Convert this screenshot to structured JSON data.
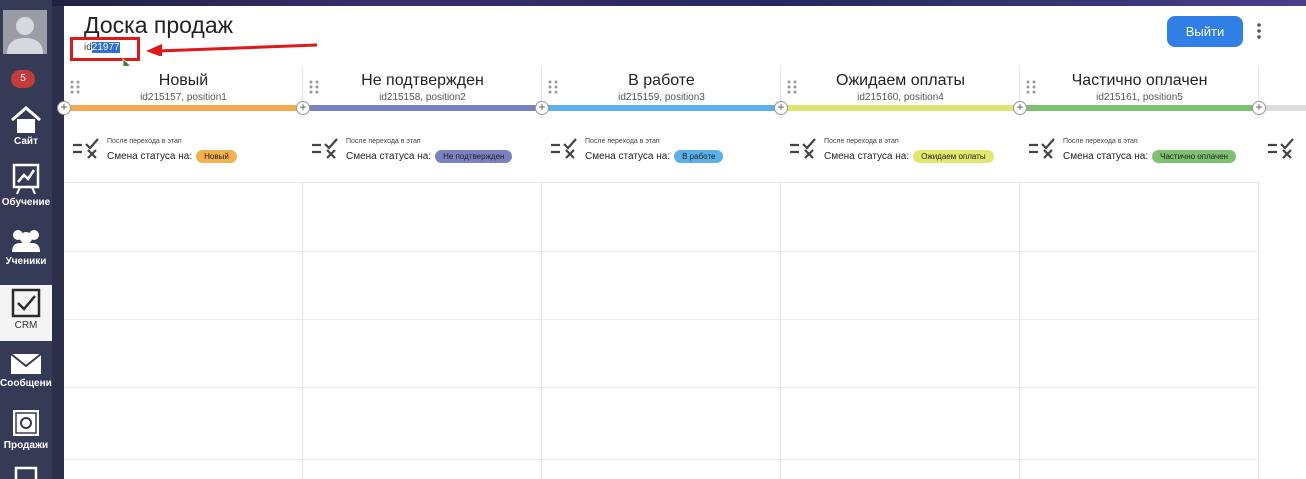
{
  "sidebar": {
    "badge": "5",
    "items": [
      {
        "label": "Сайт"
      },
      {
        "label": "Обучение"
      },
      {
        "label": "Ученики"
      },
      {
        "label": "CRM"
      },
      {
        "label": "Сообщения"
      },
      {
        "label": "Продажи"
      }
    ]
  },
  "header": {
    "title": "Доска продаж",
    "id_prefix": "id",
    "id_selected": "21977",
    "exit_label": "Выйти"
  },
  "rule_small_text": "После перехода в этап",
  "rule_main_text": "Смена статуса на:",
  "columns": [
    {
      "title": "Новый",
      "sub": "id215157, position1",
      "color": "#f3a94c",
      "status": "Новый",
      "status_color": "#f5b04e"
    },
    {
      "title": "Не подтвержден",
      "sub": "id215158, position2",
      "color": "#7a82c4",
      "status": "Не подтвержден",
      "status_color": "#7a82c4"
    },
    {
      "title": "В работе",
      "sub": "id215159, position3",
      "color": "#5ab0ea",
      "status": "В работе",
      "status_color": "#5ab0ea"
    },
    {
      "title": "Ожидаем оплаты",
      "sub": "id215160, position4",
      "color": "#dfe46e",
      "status": "Ожидаем оплаты",
      "status_color": "#e2e86e"
    },
    {
      "title": "Частично оплачен",
      "sub": "id215161, position5",
      "color": "#7cc16f",
      "status": "Частично оплачен",
      "status_color": "#7cc16f"
    }
  ]
}
